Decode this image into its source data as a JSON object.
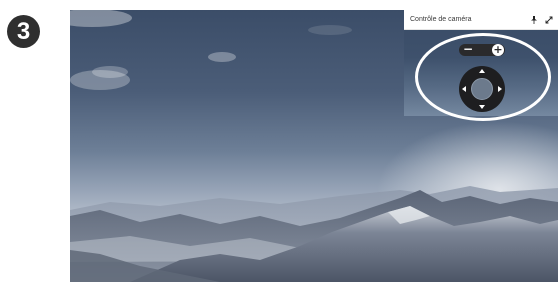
{
  "step": {
    "number": "3"
  },
  "camera_panel": {
    "title": "Contrôle de caméra",
    "pin_icon": "pin-icon",
    "expand_icon": "expand-icon",
    "zoom_out_label": "−",
    "zoom_in_label": "+"
  },
  "colors": {
    "step_badge": "#2f2f2f",
    "control_dark": "#1e1e20",
    "callout_ring": "#ffffff"
  }
}
